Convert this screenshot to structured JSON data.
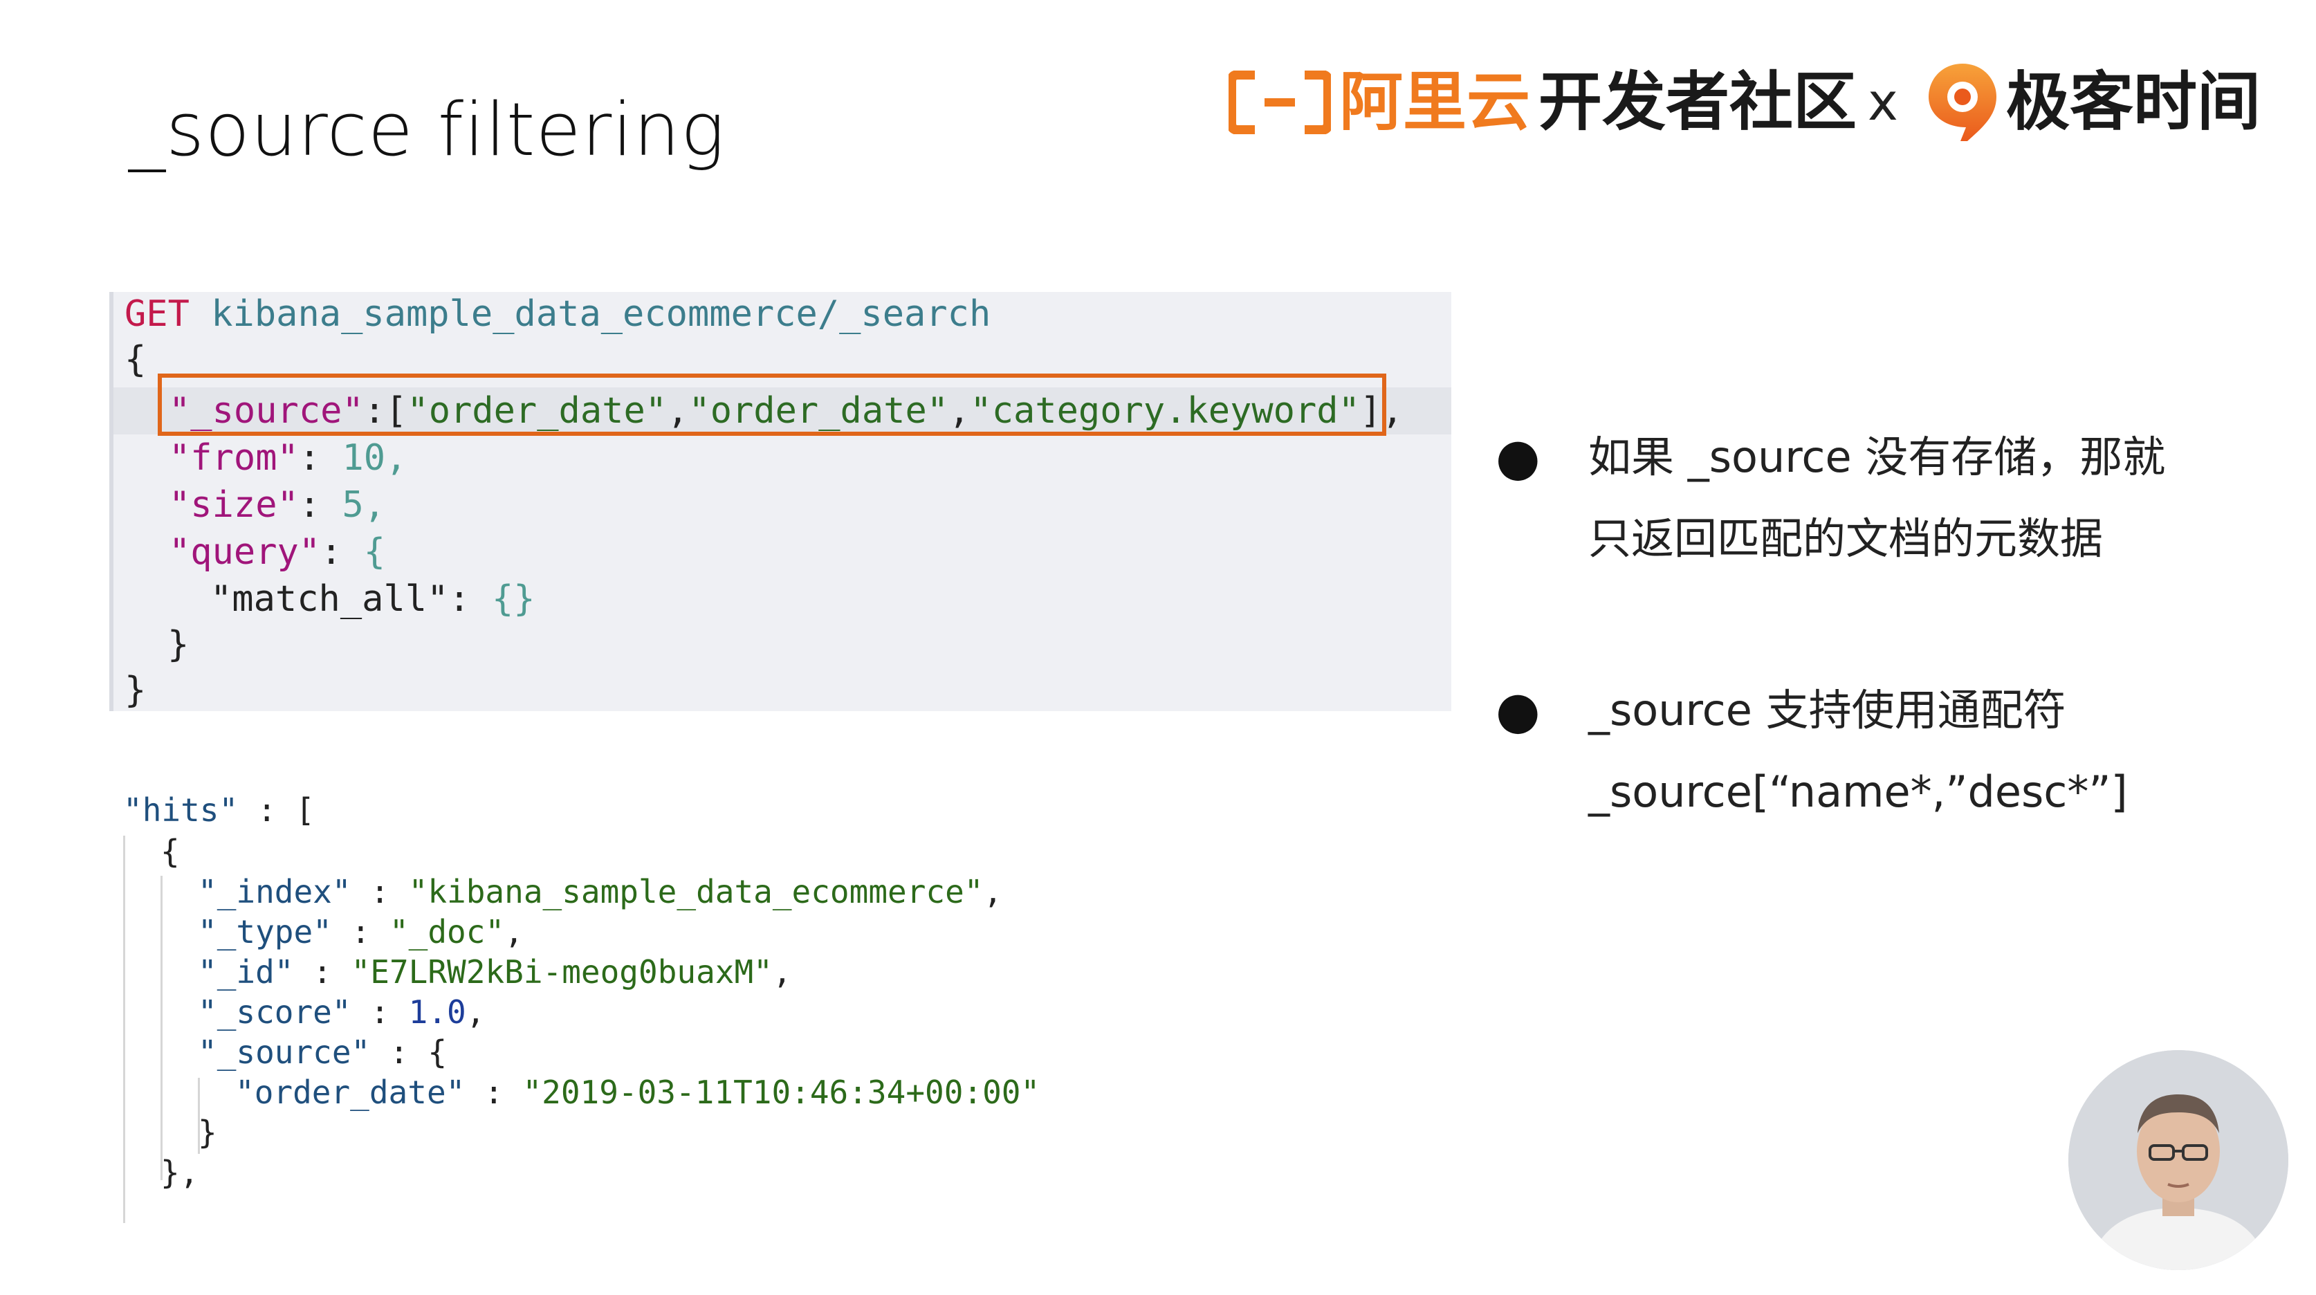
{
  "slide": {
    "title": "_source filtering"
  },
  "brand": {
    "aliyun": "阿里云",
    "community": "开发者社区",
    "times": "x",
    "geek": "极客时间",
    "accent": "#f07a1e"
  },
  "request": {
    "method": "GET",
    "path": "kibana_sample_data_ecommerce/_search",
    "open_brace": "{",
    "line_source_key": "\"_source\"",
    "line_source_colon_bracket": ":[",
    "line_source_val1": "\"order_date\"",
    "line_source_comma1": ",",
    "line_source_val2": "\"order_date\"",
    "line_source_comma2": ",",
    "line_source_val3": "\"category.keyword\"",
    "line_source_close": "],",
    "from_key": "\"from\"",
    "from_colon": ": ",
    "from_val": "10,",
    "size_key": "\"size\"",
    "size_colon": ": ",
    "size_val": "5,",
    "query_key": "\"query\"",
    "query_colon": ": ",
    "query_open": "{",
    "match_all_key": "\"match_all\"",
    "match_all_colon": ": ",
    "match_all_val": "{}",
    "query_close": "}",
    "close_brace": "}",
    "highlight_color": "#e0661a"
  },
  "response": {
    "hits_key": "\"hits\"",
    "hits_sep": " : [",
    "obj_open": "{",
    "index_key": "\"_index\"",
    "index_sep": " : ",
    "index_val": "\"kibana_sample_data_ecommerce\"",
    "index_end": ",",
    "type_key": "\"_type\"",
    "type_sep": " : ",
    "type_val": "\"_doc\"",
    "type_end": ",",
    "id_key": "\"_id\"",
    "id_sep": " : ",
    "id_val": "\"E7LRW2kBi-meog0buaxM\"",
    "id_end": ",",
    "score_key": "\"_score\"",
    "score_sep": " : ",
    "score_val": "1.0",
    "score_end": ",",
    "source_key": "\"_source\"",
    "source_sep": " : {",
    "order_date_key": "\"order_date\"",
    "order_date_sep": " : ",
    "order_date_val": "\"2019-03-11T10:46:34+00:00\"",
    "source_close": "}",
    "obj_close": "},"
  },
  "bullets": [
    {
      "line1": "如果 _source 没有存储，那就",
      "line2": "只返回匹配的文档的元数据"
    },
    {
      "line1": "_source 支持使用通配符",
      "line2": "_source[“name*,”desc*”]"
    }
  ],
  "presenter": {
    "icon": "presenter-avatar-icon"
  }
}
